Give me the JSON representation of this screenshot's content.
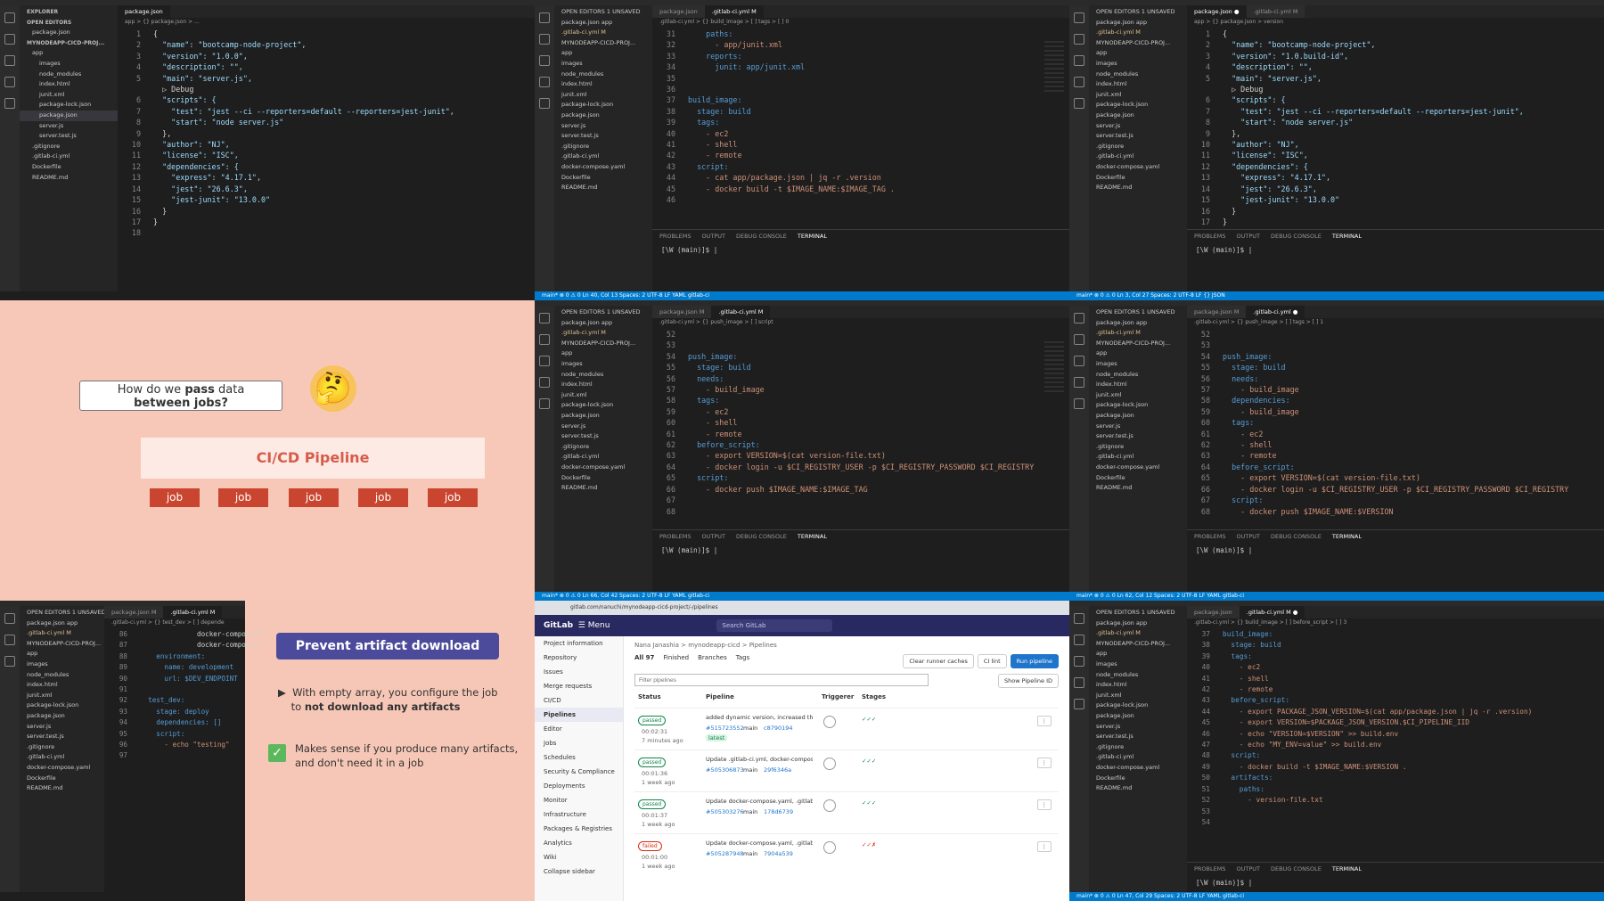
{
  "panel1": {
    "sidebar": {
      "header": "EXPLORER",
      "open_editors": "OPEN EDITORS",
      "open_file": "package.json",
      "project": "MYNODEAPP-CICD-PROJ...",
      "items": [
        "app",
        "images",
        "node_modules",
        "index.html",
        "junit.xml",
        "package-lock.json",
        "package.json",
        "server.js",
        "server.test.js",
        ".gitignore",
        ".gitlab-ci.yml",
        "Dockerfile",
        "README.md"
      ]
    },
    "tab": "package.json",
    "breadcrumb": "app > {} package.json > ...",
    "lines": [
      [
        "1",
        "{"
      ],
      [
        "2",
        "  \"name\": \"bootcamp-node-project\","
      ],
      [
        "3",
        "  \"version\": \"1.0.0\","
      ],
      [
        "4",
        "  \"description\": \"\","
      ],
      [
        "5",
        "  \"main\": \"server.js\","
      ],
      [
        "",
        "  ▷ Debug"
      ],
      [
        "6",
        "  \"scripts\": {"
      ],
      [
        "7",
        "    \"test\": \"jest --ci --reporters=default --reporters=jest-junit\","
      ],
      [
        "8",
        "    \"start\": \"node server.js\""
      ],
      [
        "9",
        "  },"
      ],
      [
        "10",
        "  \"author\": \"NJ\","
      ],
      [
        "11",
        "  \"license\": \"ISC\","
      ],
      [
        "12",
        "  \"dependencies\": {"
      ],
      [
        "13",
        "    \"express\": \"4.17.1\","
      ],
      [
        "14",
        "    \"jest\": \"26.6.3\","
      ],
      [
        "15",
        "    \"jest-junit\": \"13.0.0\""
      ],
      [
        "16",
        "  }"
      ],
      [
        "17",
        "}"
      ],
      [
        "18",
        ""
      ]
    ]
  },
  "panel2": {
    "tabs": [
      "package.json",
      ".gitlab-ci.yml M"
    ],
    "breadcrumb": ".gitlab-ci.yml > {} build_image > [ ] tags > [ ] 0",
    "sidebar_items": [
      "OPEN EDITORS  1 UNSAVED",
      "package.json app",
      ".gitlab-ci.yml M",
      "MYNODEAPP-CICD-PROJ...",
      "app",
      "images",
      "node_modules",
      "index.html",
      "junit.xml",
      "package-lock.json",
      "package.json",
      "server.js",
      "server.test.js",
      ".gitignore",
      ".gitlab-ci.yml",
      "docker-compose.yaml",
      "Dockerfile",
      "README.md"
    ],
    "lines": [
      [
        "31",
        "    paths:"
      ],
      [
        "32",
        "      - app/junit.xml"
      ],
      [
        "33",
        "    reports:"
      ],
      [
        "34",
        "      junit: app/junit.xml"
      ],
      [
        "35",
        ""
      ],
      [
        "36",
        ""
      ],
      [
        "37",
        "build_image:"
      ],
      [
        "38",
        "  stage: build"
      ],
      [
        "39",
        "  tags:"
      ],
      [
        "40",
        "    - ec2"
      ],
      [
        "41",
        "    - shell"
      ],
      [
        "42",
        "    - remote"
      ],
      [
        "43",
        "  script:"
      ],
      [
        "44",
        "    - cat app/package.json | jq -r .version"
      ],
      [
        "45",
        "    - docker build -t $IMAGE_NAME:$IMAGE_TAG ."
      ],
      [
        "46",
        ""
      ]
    ],
    "terminal_tabs": [
      "PROBLEMS",
      "OUTPUT",
      "DEBUG CONSOLE",
      "TERMINAL"
    ],
    "prompt": "[\\W (main)]$ |",
    "status": "main*   ⊗ 0 ⚠ 0        Ln 40, Col 13   Spaces: 2   UTF-8   LF   YAML   gitlab-ci"
  },
  "panel3": {
    "tabs": [
      "package.json ●",
      ".gitlab-ci.yml M"
    ],
    "breadcrumb": "app > {} package.json > version",
    "lines": [
      [
        "1",
        "{"
      ],
      [
        "2",
        "  \"name\": \"bootcamp-node-project\","
      ],
      [
        "3",
        "  \"version\": \"1.0.build-id\","
      ],
      [
        "4",
        "  \"description\": \"\","
      ],
      [
        "5",
        "  \"main\": \"server.js\","
      ],
      [
        "",
        "  ▷ Debug"
      ],
      [
        "6",
        "  \"scripts\": {"
      ],
      [
        "7",
        "    \"test\": \"jest --ci --reporters=default --reporters=jest-junit\","
      ],
      [
        "8",
        "    \"start\": \"node server.js\""
      ],
      [
        "9",
        "  },"
      ],
      [
        "10",
        "  \"author\": \"NJ\","
      ],
      [
        "11",
        "  \"license\": \"ISC\","
      ],
      [
        "12",
        "  \"dependencies\": {"
      ],
      [
        "13",
        "    \"express\": \"4.17.1\","
      ],
      [
        "14",
        "    \"jest\": \"26.6.3\","
      ],
      [
        "15",
        "    \"jest-junit\": \"13.0.0\""
      ],
      [
        "16",
        "  }"
      ],
      [
        "17",
        "}"
      ]
    ],
    "status": "main*   ⊗ 0 ⚠ 0        Ln 3, Col 27   Spaces: 2   UTF-8   LF   {} JSON"
  },
  "panel4": {
    "question_pre": "How do we ",
    "question_bold": "pass",
    "question_post": " data",
    "question_line2": "between jobs?",
    "emoji": "🤔",
    "pipeline": "CI/CD Pipeline",
    "jobs": [
      "job",
      "job",
      "job",
      "job",
      "job"
    ]
  },
  "panel5": {
    "tabs": [
      "package.json M",
      ".gitlab-ci.yml M"
    ],
    "breadcrumb": ".gitlab-ci.yml > {} push_image > [ ] script",
    "lines": [
      [
        "52",
        ""
      ],
      [
        "53",
        ""
      ],
      [
        "54",
        "push_image:"
      ],
      [
        "55",
        "  stage: build"
      ],
      [
        "56",
        "  needs:"
      ],
      [
        "57",
        "    - build_image"
      ],
      [
        "58",
        "  tags:"
      ],
      [
        "59",
        "    - ec2"
      ],
      [
        "60",
        "    - shell"
      ],
      [
        "61",
        "    - remote"
      ],
      [
        "62",
        "  before_script:"
      ],
      [
        "63",
        "    - export VERSION=$(cat version-file.txt)"
      ],
      [
        "64",
        "    - docker login -u $CI_REGISTRY_USER -p $CI_REGISTRY_PASSWORD $CI_REGISTRY"
      ],
      [
        "65",
        "  script:"
      ],
      [
        "66",
        "    - docker push $IMAGE_NAME:$IMAGE_TAG"
      ],
      [
        "67",
        ""
      ],
      [
        "68",
        ""
      ]
    ],
    "status": "main*   ⊗ 0 ⚠ 0        Ln 66, Col 42   Spaces: 2   UTF-8   LF   YAML   gitlab-ci"
  },
  "panel6": {
    "tabs": [
      "package.json M",
      ".gitlab-ci.yml ●"
    ],
    "breadcrumb": ".gitlab-ci.yml > {} push_image > [ ] tags > [ ] 1",
    "lines": [
      [
        "52",
        ""
      ],
      [
        "53",
        ""
      ],
      [
        "54",
        "push_image:"
      ],
      [
        "55",
        "  stage: build"
      ],
      [
        "56",
        "  needs:"
      ],
      [
        "57",
        "    - build_image"
      ],
      [
        "58",
        "  dependencies:"
      ],
      [
        "59",
        "    - build_image"
      ],
      [
        "60",
        "  tags:"
      ],
      [
        "61",
        "    - ec2"
      ],
      [
        "62",
        "    - shell"
      ],
      [
        "63",
        "    - remote"
      ],
      [
        "64",
        "  before_script:"
      ],
      [
        "65",
        "    - export VERSION=$(cat version-file.txt)"
      ],
      [
        "66",
        "    - docker login -u $CI_REGISTRY_USER -p $CI_REGISTRY_PASSWORD $CI_REGISTRY"
      ],
      [
        "67",
        "  script:"
      ],
      [
        "68",
        "    - docker push $IMAGE_NAME:$VERSION"
      ]
    ],
    "status": "main*   ⊗ 0 ⚠ 0        Ln 62, Col 12   Spaces: 2   UTF-8   LF   YAML   gitlab-ci"
  },
  "panel7": {
    "tabs": [
      "package.json M",
      ".gitlab-ci.yml M"
    ],
    "breadcrumb": ".gitlab-ci.yml > {} test_dev > [ ] depende",
    "lines": [
      [
        "86",
        "              docker-compose d"
      ],
      [
        "87",
        "              docker-compose u"
      ],
      [
        "88",
        "    environment:"
      ],
      [
        "89",
        "      name: development"
      ],
      [
        "90",
        "      url: $DEV_ENDPOINT"
      ],
      [
        "91",
        ""
      ],
      [
        "92",
        "  test_dev:"
      ],
      [
        "93",
        "    stage: deploy"
      ],
      [
        "94",
        "    dependencies: []"
      ],
      [
        "95",
        "    script:"
      ],
      [
        "96",
        "      - echo \"testing\""
      ],
      [
        "97",
        ""
      ]
    ],
    "title": "Prevent artifact download",
    "bullet1_a": "With empty array, you configure the job",
    "bullet1_b": "to ",
    "bullet1_bold": "not download any artifacts",
    "bullet2_a": "Makes sense if you produce many artifacts,",
    "bullet2_b": "and don't need it in a job"
  },
  "panel8": {
    "url": "gitlab.com/nanuchi/mynodeapp-cicd-project/-/pipelines",
    "logo": "GitLab",
    "menu": "Menu",
    "search": "Search GitLab",
    "project": "mynodeapp-cicd",
    "nav": [
      "Project information",
      "Repository",
      "Issues",
      "Merge requests",
      "CI/CD",
      "Pipelines",
      "Editor",
      "Jobs",
      "Schedules",
      "Security & Compliance",
      "Deployments",
      "Monitor",
      "Infrastructure",
      "Packages & Registries",
      "Analytics",
      "Wiki",
      "Collapse sidebar"
    ],
    "breadcrumb": "Nana Janashia > mynodeapp-cicd > Pipelines",
    "filters": [
      "All 97",
      "Finished",
      "Branches",
      "Tags"
    ],
    "buttons": [
      "Clear runner caches",
      "CI lint",
      "Run pipeline"
    ],
    "filter_placeholder": "Filter pipelines",
    "show_id": "Show Pipeline ID",
    "cols": [
      "Status",
      "Pipeline",
      "Triggerer",
      "Stages"
    ],
    "rows": [
      {
        "status": "passed",
        "time": "00:02:31",
        "ago": "7 minutes ago",
        "title": "added dynamic version, increased the patch...",
        "id": "#515723552",
        "branch": "main",
        "sha": "c8790194",
        "tag": "latest"
      },
      {
        "status": "passed",
        "time": "00:01:36",
        "ago": "1 week ago",
        "title": "Update .gitlab-ci.yml, docker-compose.yaml",
        "id": "#505306873",
        "branch": "main",
        "sha": "29f6346a",
        "tag": ""
      },
      {
        "status": "passed",
        "time": "00:01:37",
        "ago": "1 week ago",
        "title": "Update docker-compose.yaml, .gitlab-ci.yml",
        "id": "#505303276",
        "branch": "main",
        "sha": "178d6739",
        "tag": ""
      },
      {
        "status": "failed",
        "time": "00:01:00",
        "ago": "1 week ago",
        "title": "Update docker-compose.yaml, .gitlab-ci.yml",
        "id": "#505287948",
        "branch": "main",
        "sha": "7904a539",
        "tag": ""
      }
    ]
  },
  "panel9": {
    "tabs": [
      "package.json",
      ".gitlab-ci.yml M ●"
    ],
    "breadcrumb": ".gitlab-ci.yml > {} build_image > [ ] before_script > [ ] 3",
    "lines": [
      [
        "37",
        "build_image:"
      ],
      [
        "38",
        "  stage: build"
      ],
      [
        "39",
        "  tags:"
      ],
      [
        "40",
        "    - ec2"
      ],
      [
        "41",
        "    - shell"
      ],
      [
        "42",
        "    - remote"
      ],
      [
        "43",
        "  before_script:"
      ],
      [
        "44",
        "    - export PACKAGE_JSON_VERSION=$(cat app/package.json | jq -r .version)"
      ],
      [
        "45",
        "    - export VERSION=$PACKAGE_JSON_VERSION.$CI_PIPELINE_IID"
      ],
      [
        "46",
        "    - echo \"VERSION=$VERSION\" >> build.env"
      ],
      [
        "47",
        "    - echo \"MY_ENV=value\" >> build.env"
      ],
      [
        "48",
        "  script:"
      ],
      [
        "49",
        "    - docker build -t $IMAGE_NAME:$VERSION ."
      ],
      [
        "50",
        "  artifacts:"
      ],
      [
        "51",
        "    paths:"
      ],
      [
        "52",
        "      - version-file.txt"
      ],
      [
        "53",
        ""
      ],
      [
        "54",
        ""
      ]
    ],
    "status": "main*   ⊗ 0 ⚠ 0        Ln 47, Col 29   Spaces: 2   UTF-8   LF   YAML   gitlab-ci"
  }
}
